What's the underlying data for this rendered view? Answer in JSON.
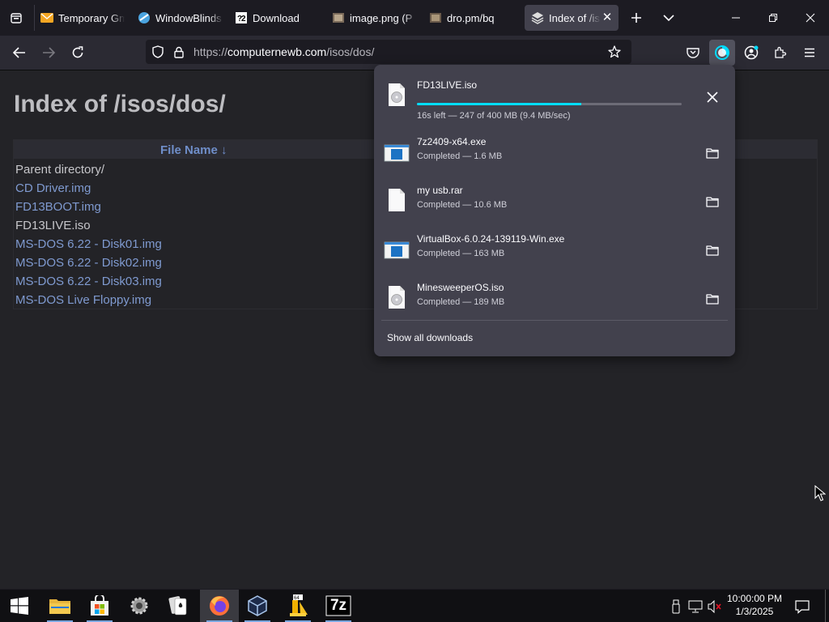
{
  "browser": {
    "tabs": [
      {
        "title": "Temporary Gm",
        "icon": "mail-icon"
      },
      {
        "title": "WindowBlinds",
        "icon": "windowblinds-icon"
      },
      {
        "title": "Download",
        "icon": "download-site-icon"
      },
      {
        "title": "image.png (P",
        "icon": "image-file-icon"
      },
      {
        "title": "dro.pm/bq",
        "icon": "dro-pm-icon"
      },
      {
        "title": "Index of /is",
        "icon": "stack-icon",
        "active": true
      }
    ],
    "url": {
      "prefix": "https://",
      "host": "computernewb.com",
      "path": "/isos/dos/"
    }
  },
  "page": {
    "heading": "Index of /isos/dos/",
    "table_header": "File Name  ↓",
    "entries": [
      {
        "name": "Parent directory/",
        "link": false
      },
      {
        "name": "CD Driver.img",
        "link": true
      },
      {
        "name": "FD13BOOT.img",
        "link": true
      },
      {
        "name": "FD13LIVE.iso",
        "link": false
      },
      {
        "name": "MS-DOS 6.22 - Disk01.img",
        "link": true
      },
      {
        "name": "MS-DOS 6.22 - Disk02.img",
        "link": true
      },
      {
        "name": "MS-DOS 6.22 - Disk03.img",
        "link": true
      },
      {
        "name": "MS-DOS Live Floppy.img",
        "link": true
      }
    ]
  },
  "downloads": {
    "items": [
      {
        "name": "FD13LIVE.iso",
        "status": "16s left — 247 of 400 MB (9.4 MB/sec)",
        "progress_fraction": 0.62,
        "action": "cancel-icon",
        "file_icon": "disc-image-icon"
      },
      {
        "name": "7z2409-x64.exe",
        "status": "Completed — 1.6 MB",
        "action": "folder-icon",
        "file_icon": "exe-icon"
      },
      {
        "name": "my usb.rar",
        "status": "Completed — 10.6 MB",
        "action": "folder-icon",
        "file_icon": "file-icon"
      },
      {
        "name": "VirtualBox-6.0.24-139119-Win.exe",
        "status": "Completed — 163 MB",
        "action": "folder-icon",
        "file_icon": "exe-icon"
      },
      {
        "name": "MinesweeperOS.iso",
        "status": "Completed — 189 MB",
        "action": "folder-icon",
        "file_icon": "disc-image-icon"
      }
    ],
    "show_all": "Show all downloads"
  },
  "taskbar": {
    "time": "10:00:00 PM",
    "date": "1/3/2025",
    "apps": [
      "start-icon",
      "file-explorer-icon",
      "store-icon",
      "settings-gear-icon",
      "solitaire-icon",
      "firefox-icon",
      "virtualbox-icon",
      "app-64-icon",
      "7zip-icon"
    ],
    "app_7zip_label": "7z"
  },
  "colors": {
    "accent": "#00ddff",
    "link": "#7f9ad0",
    "panel": "#42414d"
  }
}
